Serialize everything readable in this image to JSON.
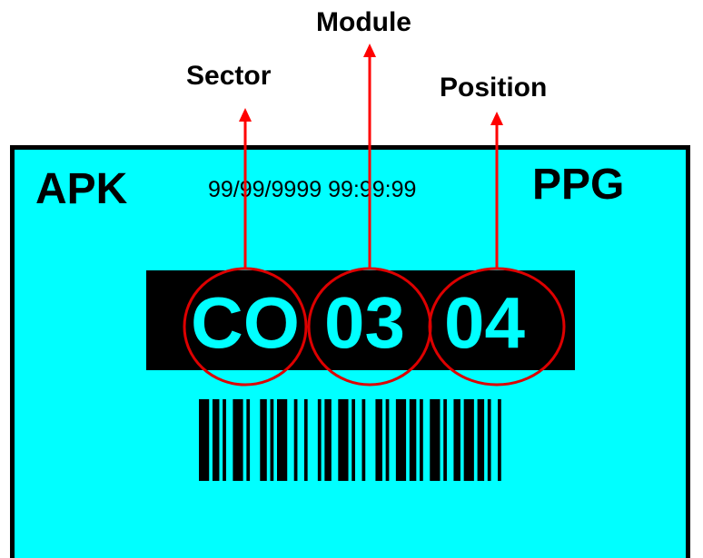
{
  "callouts": {
    "sector": "Sector",
    "module": "Module",
    "position": "Position"
  },
  "label": {
    "left_code": "APK",
    "right_code": "PPG",
    "timestamp": "99/99/9999  99:99:99",
    "location": {
      "sector": "CO",
      "module": "03",
      "position": "04"
    }
  },
  "colors": {
    "label_background": "#00ffff",
    "code_text": "#00ffff",
    "circle": "#dd0000",
    "arrow": "#ff0000",
    "bar": "#000000"
  },
  "icons": {
    "barcode": "barcode-icon"
  }
}
